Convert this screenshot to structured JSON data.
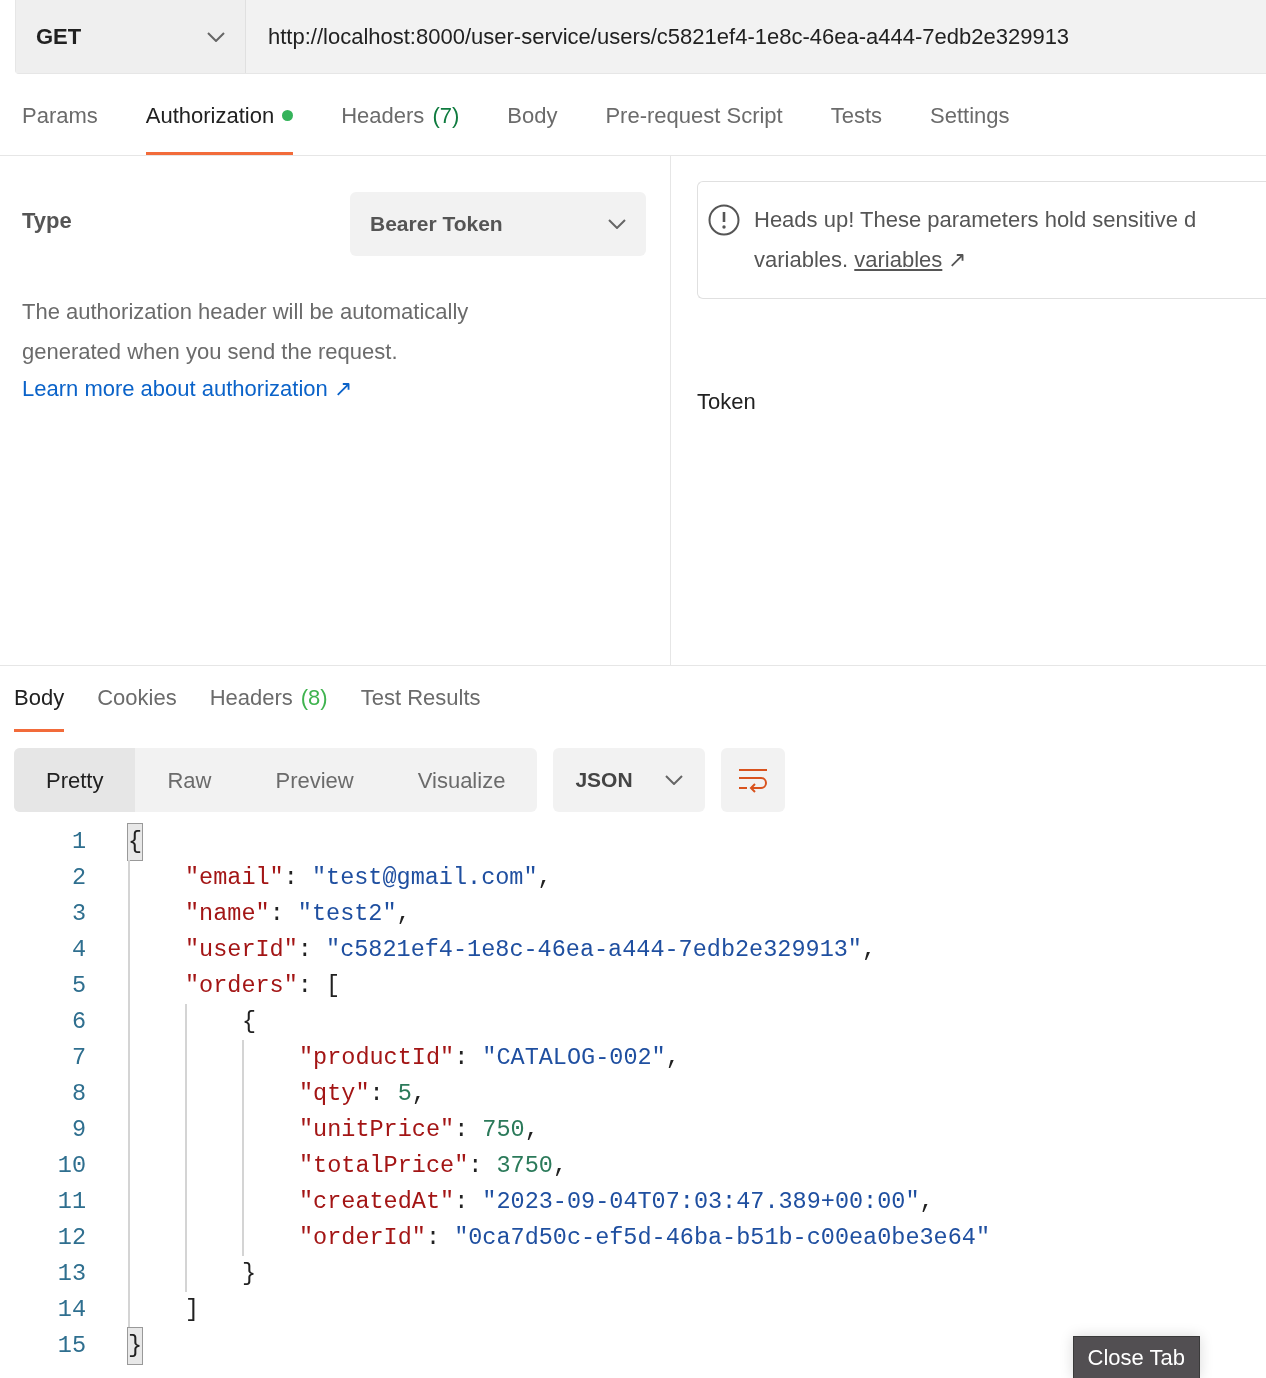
{
  "request": {
    "method": "GET",
    "url": "http://localhost:8000/user-service/users/c5821ef4-1e8c-46ea-a444-7edb2e329913"
  },
  "request_tabs": [
    {
      "label": "Params",
      "selected": false,
      "dot": false
    },
    {
      "label": "Authorization",
      "selected": true,
      "dot": true
    },
    {
      "label": "Headers",
      "count": "(7)",
      "selected": false,
      "dot": false
    },
    {
      "label": "Body",
      "selected": false,
      "dot": false
    },
    {
      "label": "Pre-request Script",
      "selected": false,
      "dot": false
    },
    {
      "label": "Tests",
      "selected": false,
      "dot": false
    },
    {
      "label": "Settings",
      "selected": false,
      "dot": false
    }
  ],
  "auth": {
    "type_label": "Type",
    "type_value": "Bearer Token",
    "description": "The authorization header will be automatically generated when you send the request.",
    "learn_link": "Learn more about authorization ↗",
    "notice": {
      "line_1": "Heads up! These parameters hold sensitive d",
      "line_2": "variables.",
      "link": "variables",
      "link_arrow": "↗"
    },
    "token_label": "Token"
  },
  "response_tabs": [
    {
      "label": "Body",
      "selected": true
    },
    {
      "label": "Cookies",
      "selected": false
    },
    {
      "label": "Headers",
      "count": "(8)",
      "selected": false
    },
    {
      "label": "Test Results",
      "selected": false
    }
  ],
  "formats": [
    {
      "label": "Pretty",
      "selected": true
    },
    {
      "label": "Raw",
      "selected": false
    },
    {
      "label": "Preview",
      "selected": false
    },
    {
      "label": "Visualize",
      "selected": false
    }
  ],
  "language": "JSON",
  "code": [
    {
      "number": "1",
      "tokens": [
        {
          "kind": "punct",
          "text": "{"
        }
      ],
      "matched": true,
      "children": [
        {
          "number": "2",
          "tokens": [
            {
              "kind": "key",
              "text": "\"email\""
            },
            {
              "kind": "punct",
              "text": ": "
            },
            {
              "kind": "string",
              "text": "\"test@gmail.com\""
            },
            {
              "kind": "punct",
              "text": ","
            }
          ]
        },
        {
          "number": "3",
          "tokens": [
            {
              "kind": "key",
              "text": "\"name\""
            },
            {
              "kind": "punct",
              "text": ": "
            },
            {
              "kind": "string",
              "text": "\"test2\""
            },
            {
              "kind": "punct",
              "text": ","
            }
          ]
        },
        {
          "number": "4",
          "tokens": [
            {
              "kind": "key",
              "text": "\"userId\""
            },
            {
              "kind": "punct",
              "text": ": "
            },
            {
              "kind": "string",
              "text": "\"c5821ef4-1e8c-46ea-a444-7edb2e329913\""
            },
            {
              "kind": "punct",
              "text": ","
            }
          ]
        },
        {
          "number": "5",
          "tokens": [
            {
              "kind": "key",
              "text": "\"orders\""
            },
            {
              "kind": "punct",
              "text": ": ["
            }
          ],
          "children": [
            {
              "number": "6",
              "tokens": [
                {
                  "kind": "punct",
                  "text": "{"
                }
              ],
              "children": [
                {
                  "number": "7",
                  "tokens": [
                    {
                      "kind": "key",
                      "text": "\"productId\""
                    },
                    {
                      "kind": "punct",
                      "text": ": "
                    },
                    {
                      "kind": "string",
                      "text": "\"CATALOG-002\""
                    },
                    {
                      "kind": "punct",
                      "text": ","
                    }
                  ]
                },
                {
                  "number": "8",
                  "tokens": [
                    {
                      "kind": "key",
                      "text": "\"qty\""
                    },
                    {
                      "kind": "punct",
                      "text": ": "
                    },
                    {
                      "kind": "number",
                      "text": "5"
                    },
                    {
                      "kind": "punct",
                      "text": ","
                    }
                  ]
                },
                {
                  "number": "9",
                  "tokens": [
                    {
                      "kind": "key",
                      "text": "\"unitPrice\""
                    },
                    {
                      "kind": "punct",
                      "text": ": "
                    },
                    {
                      "kind": "number",
                      "text": "750"
                    },
                    {
                      "kind": "punct",
                      "text": ","
                    }
                  ]
                },
                {
                  "number": "10",
                  "tokens": [
                    {
                      "kind": "key",
                      "text": "\"totalPrice\""
                    },
                    {
                      "kind": "punct",
                      "text": ": "
                    },
                    {
                      "kind": "number",
                      "text": "3750"
                    },
                    {
                      "kind": "punct",
                      "text": ","
                    }
                  ]
                },
                {
                  "number": "11",
                  "tokens": [
                    {
                      "kind": "key",
                      "text": "\"createdAt\""
                    },
                    {
                      "kind": "punct",
                      "text": ": "
                    },
                    {
                      "kind": "string",
                      "text": "\"2023-09-04T07:03:47.389+00:00\""
                    },
                    {
                      "kind": "punct",
                      "text": ","
                    }
                  ]
                },
                {
                  "number": "12",
                  "tokens": [
                    {
                      "kind": "key",
                      "text": "\"orderId\""
                    },
                    {
                      "kind": "punct",
                      "text": ": "
                    },
                    {
                      "kind": "string",
                      "text": "\"0ca7d50c-ef5d-46ba-b51b-c00ea0be3e64\""
                    }
                  ]
                }
              ]
            },
            {
              "number": "13",
              "tokens": [
                {
                  "kind": "punct",
                  "text": "}"
                }
              ]
            }
          ]
        },
        {
          "number": "14",
          "tokens": [
            {
              "kind": "punct",
              "text": "]"
            }
          ]
        }
      ]
    },
    {
      "number": "15",
      "tokens": [
        {
          "kind": "punct",
          "text": "}"
        }
      ],
      "matched": true
    }
  ],
  "tooltip": "Close Tab"
}
